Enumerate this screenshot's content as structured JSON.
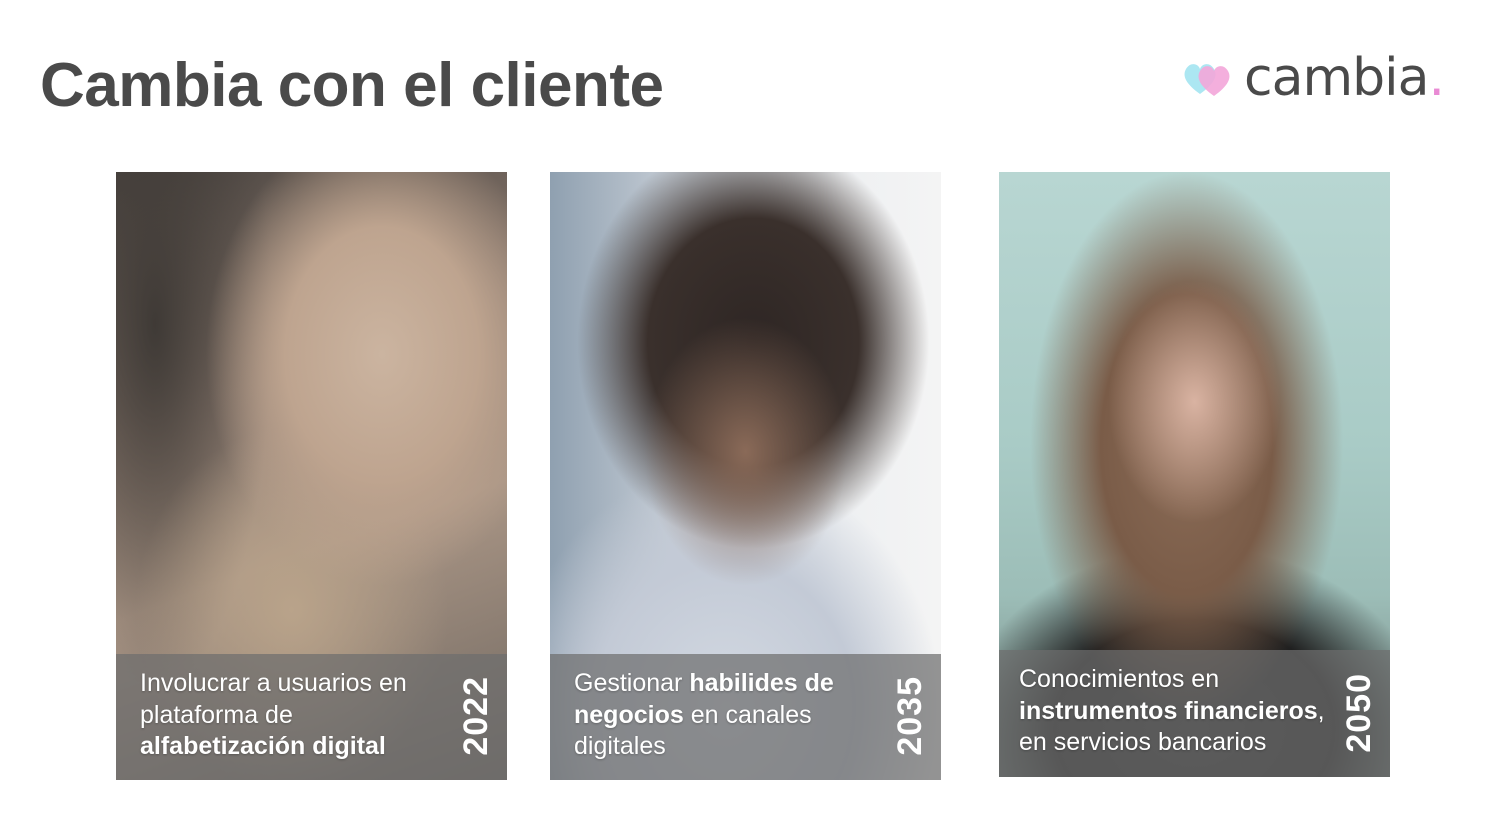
{
  "header": {
    "title": "Cambia con el cliente",
    "logo_text": "cambia",
    "logo_dot": "."
  },
  "brand_colors": {
    "heart_pink": "#f3a6d9",
    "heart_blue": "#9ee3f0",
    "title_gray": "#4a4a4a"
  },
  "cards": [
    {
      "image": "woman-with-earbud-and-chain-necklace-photo",
      "caption_parts": [
        "Involucrar a usuarios en plataforma de ",
        "alfabetización digital"
      ],
      "year": "2022"
    },
    {
      "image": "woman-with-curly-hair-on-phone-photo",
      "caption_parts": [
        "Gestionar ",
        "habilides de negocios",
        " en canales digitales"
      ],
      "year": "2035"
    },
    {
      "image": "woman-with-red-lipstick-photo",
      "caption_parts": [
        "Conocimientos en ",
        "instrumentos financieros",
        ", en servicios bancarios"
      ],
      "year": "2050"
    }
  ]
}
